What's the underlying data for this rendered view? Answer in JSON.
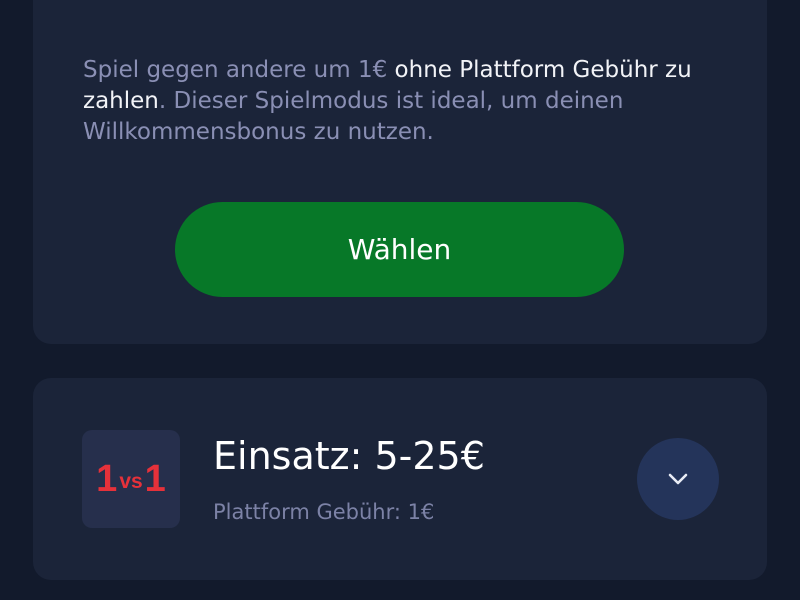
{
  "offer_card": {
    "description_before": "Spiel gegen andere um 1€ ",
    "description_highlight": "ohne Plattform Gebühr zu zahlen",
    "description_after": ". Dieser Spielmodus ist ideal, um deinen Willkommensbonus zu nutzen.",
    "select_label": "Wählen",
    "button_color": "#077828"
  },
  "mode_card": {
    "icon": {
      "left": "1",
      "middle": "vs",
      "right": "1",
      "color": "#e6313a"
    },
    "stake_title": "Einsatz: 5-25€",
    "fee_text": "Plattform Gebühr: 1€",
    "expand_icon": "chevron-down-icon"
  }
}
